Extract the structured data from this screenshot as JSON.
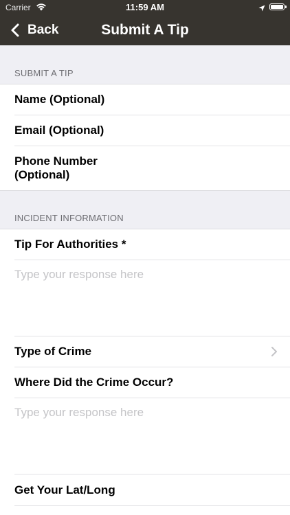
{
  "status_bar": {
    "carrier": "Carrier",
    "time": "11:59 AM",
    "icons": [
      "wifi-icon",
      "location-arrow-icon",
      "battery-icon"
    ]
  },
  "nav": {
    "back_label": "Back",
    "title": "Submit A Tip",
    "bar_color": "#37342f"
  },
  "sections": {
    "submit": {
      "header": "SUBMIT A TIP",
      "name_label": "Name (Optional)",
      "email_label": "Email (Optional)",
      "phone_label": "Phone Number (Optional)"
    },
    "incident": {
      "header": "INCIDENT INFORMATION",
      "tip_label": "Tip For Authorities *",
      "tip_placeholder": "Type your response here",
      "crime_type_label": "Type of Crime",
      "where_label": "Where Did the Crime Occur?",
      "where_placeholder": "Type your response here",
      "latlong_label": "Get Your Lat/Long"
    }
  }
}
